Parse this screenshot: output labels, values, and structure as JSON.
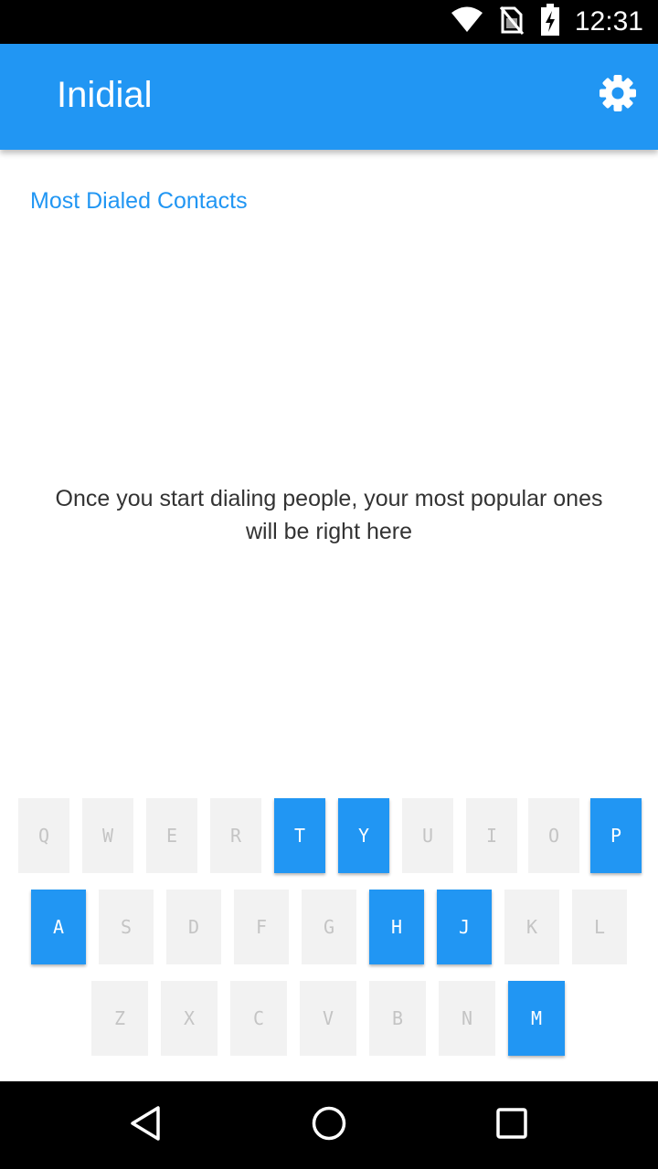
{
  "status_bar": {
    "time": "12:31",
    "icons": [
      "wifi-icon",
      "no-sim-icon",
      "battery-charging-icon"
    ]
  },
  "app_bar": {
    "title": "Inidial",
    "settings_icon": "gear-icon",
    "color": "#2196f3"
  },
  "main": {
    "section_title": "Most Dialed Contacts",
    "empty_message": "Once you start dialing people, your most popular ones will be right here"
  },
  "keyboard": {
    "active_color": "#2196f3",
    "inactive_color": "#f2f2f2",
    "rows": [
      [
        {
          "label": "Q",
          "active": false
        },
        {
          "label": "W",
          "active": false
        },
        {
          "label": "E",
          "active": false
        },
        {
          "label": "R",
          "active": false
        },
        {
          "label": "T",
          "active": true
        },
        {
          "label": "Y",
          "active": true
        },
        {
          "label": "U",
          "active": false
        },
        {
          "label": "I",
          "active": false
        },
        {
          "label": "O",
          "active": false
        },
        {
          "label": "P",
          "active": true
        }
      ],
      [
        {
          "label": "A",
          "active": true
        },
        {
          "label": "S",
          "active": false
        },
        {
          "label": "D",
          "active": false
        },
        {
          "label": "F",
          "active": false
        },
        {
          "label": "G",
          "active": false
        },
        {
          "label": "H",
          "active": true
        },
        {
          "label": "J",
          "active": true
        },
        {
          "label": "K",
          "active": false
        },
        {
          "label": "L",
          "active": false
        }
      ],
      [
        {
          "label": "Z",
          "active": false
        },
        {
          "label": "X",
          "active": false
        },
        {
          "label": "C",
          "active": false
        },
        {
          "label": "V",
          "active": false
        },
        {
          "label": "B",
          "active": false
        },
        {
          "label": "N",
          "active": false
        },
        {
          "label": "M",
          "active": true
        }
      ]
    ]
  },
  "nav_bar": {
    "back_icon": "back-icon",
    "home_icon": "home-icon",
    "recents_icon": "recents-icon"
  }
}
